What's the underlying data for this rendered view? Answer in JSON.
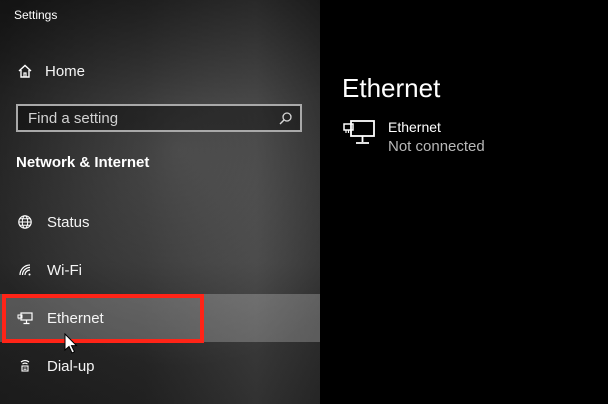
{
  "window": {
    "title": "Settings"
  },
  "sidebar": {
    "home_label": "Home",
    "search": {
      "placeholder": "Find a setting",
      "value": ""
    },
    "section_title": "Network & Internet",
    "items": [
      {
        "label": "Status",
        "icon": "globe-icon",
        "selected": false
      },
      {
        "label": "Wi-Fi",
        "icon": "wifi-icon",
        "selected": false
      },
      {
        "label": "Ethernet",
        "icon": "ethernet-icon",
        "selected": true
      },
      {
        "label": "Dial-up",
        "icon": "dialup-icon",
        "selected": false
      }
    ]
  },
  "main": {
    "title": "Ethernet",
    "network": {
      "name": "Ethernet",
      "status": "Not connected",
      "icon": "ethernet-monitor-icon"
    }
  },
  "colors": {
    "highlight_border": "#ff2417",
    "selected_background": "#5b5b5b",
    "content_background": "#000000",
    "status_text": "#b8b8b8"
  }
}
